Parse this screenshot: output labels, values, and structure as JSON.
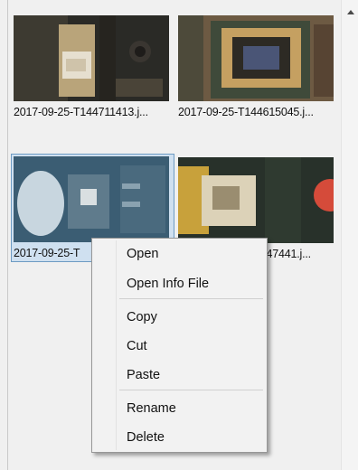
{
  "thumbnails": [
    {
      "label": "2017-09-25-T144711413.j..."
    },
    {
      "label": "2017-09-25-T144615045.j..."
    },
    {
      "label": "2017-09-25-T"
    },
    {
      "label": "4547441.j..."
    }
  ],
  "context_menu": {
    "open": "Open",
    "open_info_file": "Open Info File",
    "copy": "Copy",
    "cut": "Cut",
    "paste": "Paste",
    "rename": "Rename",
    "delete": "Delete"
  },
  "scrollbar": {
    "up_icon": "scroll-up-arrow-icon"
  },
  "colors": {
    "selection_fill": "#cfe0f0",
    "selection_border": "#6d9bc3",
    "menu_background": "#f2f2f2"
  }
}
